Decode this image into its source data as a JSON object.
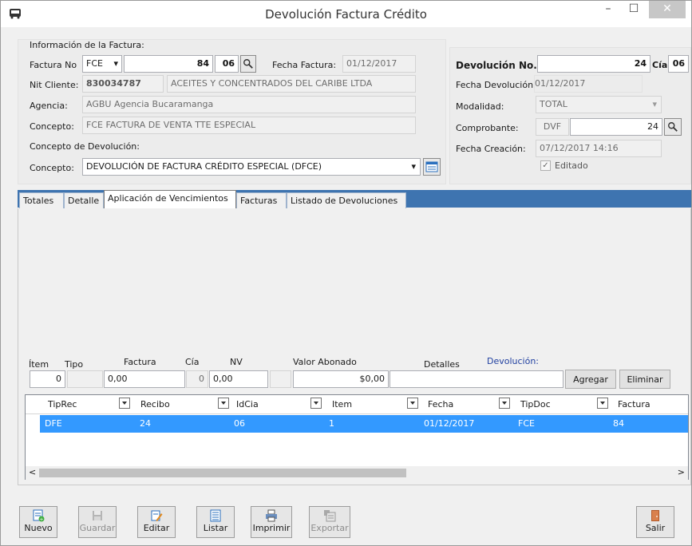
{
  "window": {
    "title": "Devolución Factura Crédito",
    "min_glyph": "–",
    "max_glyph": "☐",
    "close_glyph": "✕"
  },
  "invoice_info": {
    "section_label": "Información de la Factura:",
    "factura_no_label": "Factura No",
    "factura_type": "FCE",
    "factura_number": "84",
    "factura_cia": "06",
    "fecha_factura_label": "Fecha Factura:",
    "fecha_factura": "01/12/2017",
    "nit_label": "Nit Cliente:",
    "nit_value": "830034787",
    "client_name": "ACEITES Y CONCENTRADOS DEL CARIBE  LTDA",
    "agencia_label": "Agencia:",
    "agencia_value": "AGBU Agencia Bucaramanga",
    "concepto_label": "Concepto:",
    "concepto_value": "FCE FACTURA DE VENTA TTE ESPECIAL"
  },
  "return_concept": {
    "section_label": "Concepto de Devolución:",
    "concepto_label": "Concepto:",
    "concepto_value": "DEVOLUCIÓN DE FACTURA CRÉDITO ESPECIAL (DFCE)"
  },
  "return_info": {
    "devolucion_no_label": "Devolución No.",
    "devolucion_no": "24",
    "cia_label": "Cía:",
    "cia_value": "06",
    "fecha_devolucion_label": "Fecha Devolución",
    "fecha_devolucion": "01/12/2017",
    "modalidad_label": "Modalidad:",
    "modalidad_value": "TOTAL",
    "comprobante_label": "Comprobante:",
    "comprobante_prefix": "DVF",
    "comprobante_number": "24",
    "fecha_creacion_label": "Fecha Creación:",
    "fecha_creacion": "07/12/2017 14:16",
    "editado_label": "Editado",
    "editado_checked": true
  },
  "tabs": [
    {
      "label": "Totales"
    },
    {
      "label": "Detalle"
    },
    {
      "label": "Aplicación de Vencimientos"
    },
    {
      "label": "Facturas"
    },
    {
      "label": "Listado de Devoluciones"
    }
  ],
  "active_tab": "Aplicación de Vencimientos",
  "entry": {
    "item_label": "Ítem",
    "tipo_label": "Tipo",
    "factura_label": "Factura",
    "cia_label": "Cía",
    "nv_label": "NV",
    "valor_label": "Valor Abonado",
    "detalles_label": "Detalles",
    "devolucion_label": "Devolución:",
    "item_value": "0",
    "factura_value": "0,00",
    "cia_value": "0",
    "nv_value": "0,00",
    "valor_value": "$0,00",
    "agregar_label": "Agregar",
    "eliminar_label": "Eliminar"
  },
  "grid": {
    "columns": [
      "TipRec",
      "Recibo",
      "IdCia",
      "Item",
      "Fecha",
      "TipDoc",
      "Factura"
    ],
    "rows": [
      [
        "DFE",
        "24",
        "06",
        "1",
        "01/12/2017",
        "FCE",
        "84"
      ]
    ],
    "scroll_left_glyph": "<",
    "scroll_right_glyph": ">"
  },
  "toolbar": {
    "nuevo": "Nuevo",
    "guardar": "Guardar",
    "editar": "Editar",
    "listar": "Listar",
    "imprimir": "Imprimir",
    "exportar": "Exportar",
    "salir": "Salir"
  },
  "colors": {
    "accent": "#3e74b0",
    "selection": "#3399ff",
    "devolucion_label": "#1f3fa0"
  }
}
